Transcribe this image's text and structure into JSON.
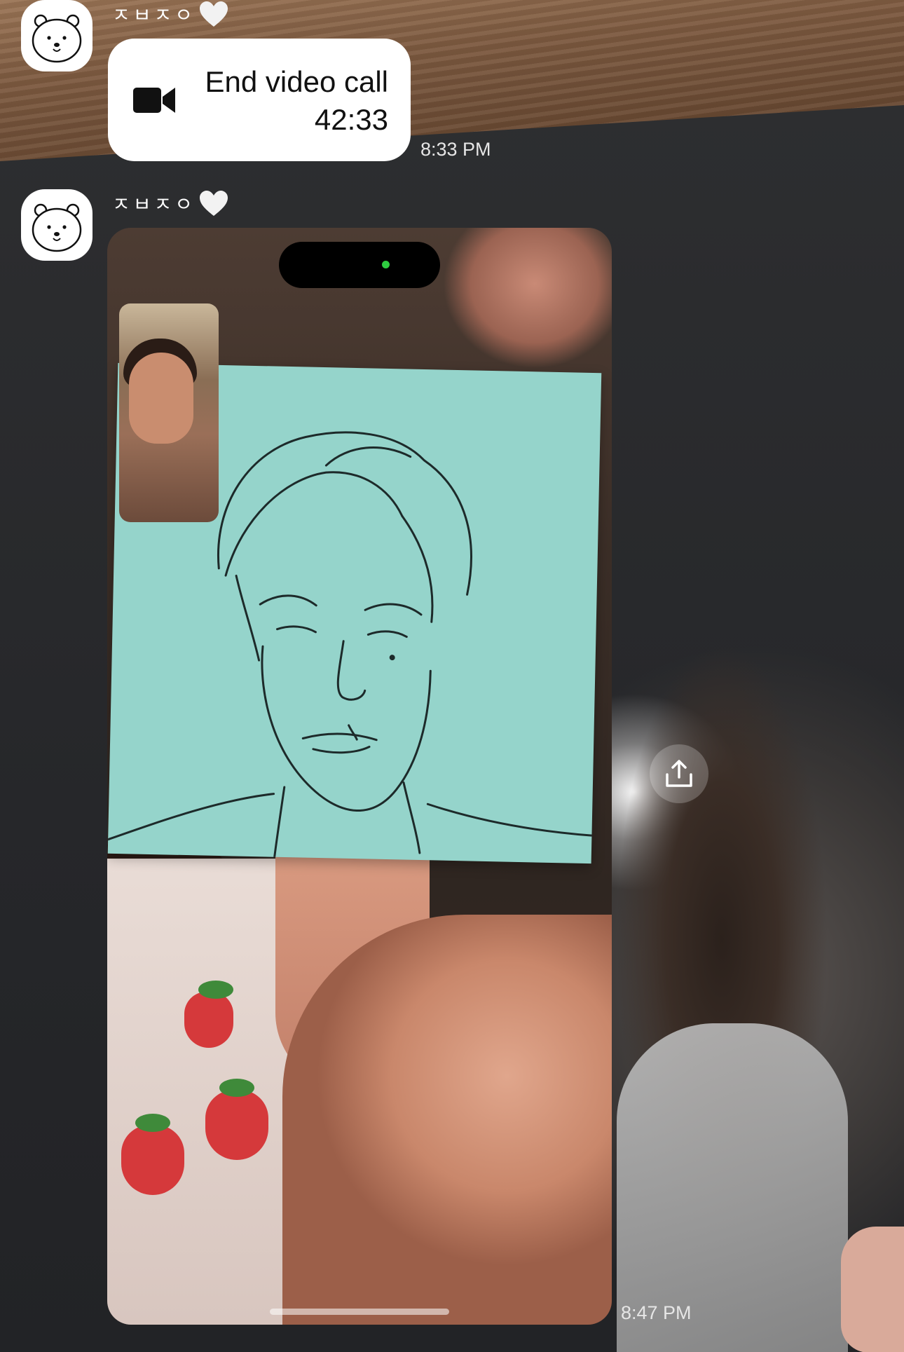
{
  "messages": [
    {
      "sender": "ㅈㅂㅈㅇ",
      "type": "call",
      "call": {
        "title": "End video call",
        "duration": "42:33"
      },
      "time": "8:33 PM"
    },
    {
      "sender": "ㅈㅂㅈㅇ",
      "type": "photo",
      "time": "8:47 PM"
    }
  ],
  "icons": {
    "avatar": "bear-avatar-icon",
    "heart": "white-heart-icon",
    "call": "video-camera-icon",
    "share": "share-icon"
  },
  "colors": {
    "bubble": "#ffffff",
    "text_dark": "#111111",
    "timestamp": "#e6e6e6",
    "island_dot": "#2ecc40",
    "sticky_note": "#95d4cb"
  }
}
